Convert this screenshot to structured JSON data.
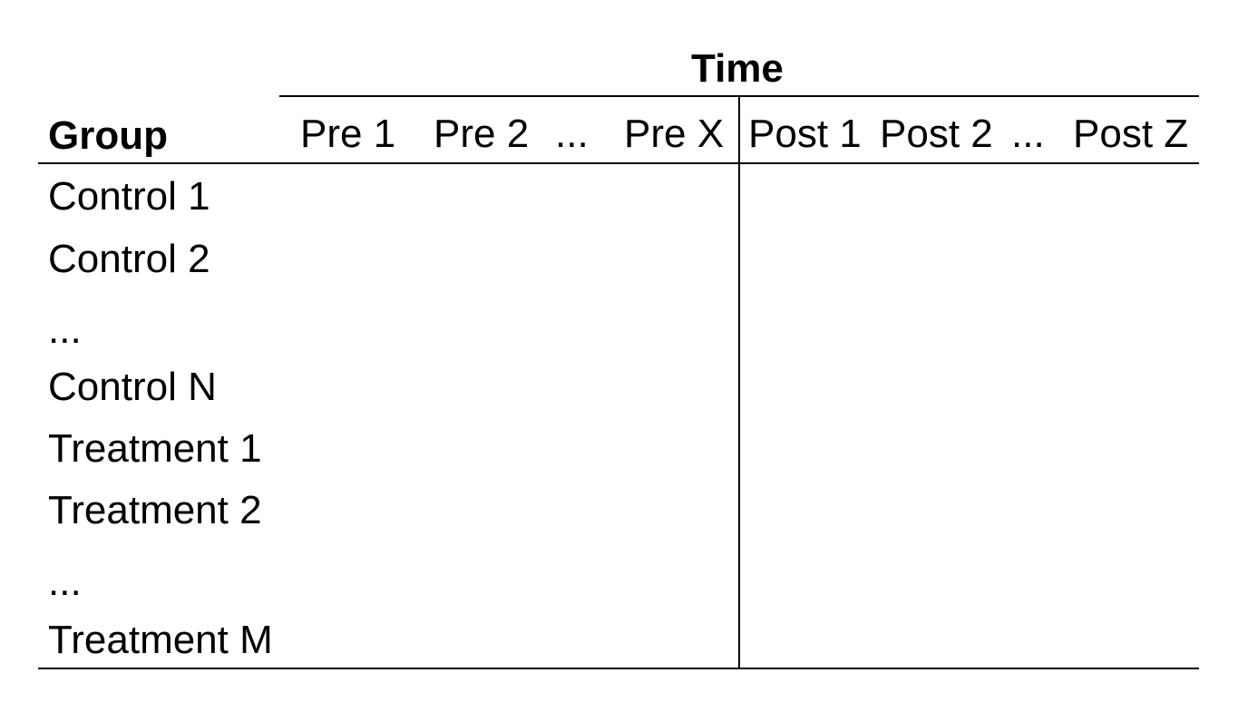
{
  "header": {
    "time_label": "Time",
    "group_label": "Group"
  },
  "columns": {
    "pre": [
      "Pre 1",
      "Pre 2",
      "...",
      "Pre X"
    ],
    "post": [
      "Post 1",
      "Post 2",
      "...",
      "Post Z"
    ]
  },
  "rows": [
    "Control 1",
    "Control 2",
    "...",
    "Control N",
    "Treatment 1",
    "Treatment 2",
    "...",
    "Treatment M"
  ]
}
